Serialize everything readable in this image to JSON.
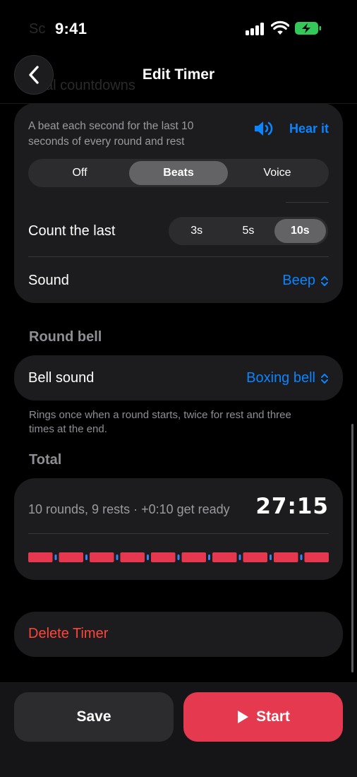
{
  "status_bar": {
    "time": "9:41"
  },
  "nav": {
    "title": "Edit Timer"
  },
  "countdown": {
    "description": "A beat each second for the last 10 seconds of every round and rest",
    "hear_it": "Hear it",
    "mode_options": [
      "Off",
      "Beats",
      "Voice"
    ],
    "mode_selected": "Beats",
    "count_last_label": "Count the last",
    "count_last_options": [
      "3s",
      "5s",
      "10s"
    ],
    "count_last_selected": "10s",
    "sound_label": "Sound",
    "sound_value": "Beep"
  },
  "round_bell": {
    "section_title": "Round bell",
    "bell_sound_label": "Bell sound",
    "bell_sound_value": "Boxing bell",
    "footnote": "Rings once when a round starts, twice for rest and three times at the end."
  },
  "total": {
    "section_title": "Total",
    "summary": "10 rounds, 9 rests · +0:10 get ready",
    "duration": "27:15",
    "rounds": 10,
    "rests": 9,
    "round_color": "#e5384f",
    "rest_color": "#3b82f6"
  },
  "delete_label": "Delete Timer",
  "actions": {
    "save_label": "Save",
    "start_label": "Start"
  },
  "colors": {
    "accent": "#0a84ff",
    "danger": "#ff453a",
    "primary": "#e53950"
  }
}
